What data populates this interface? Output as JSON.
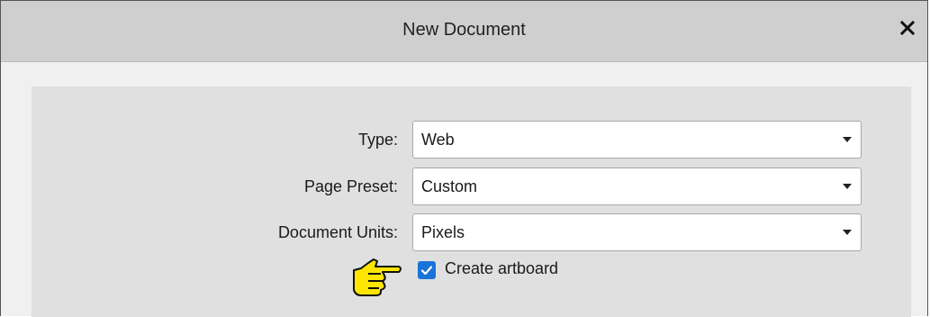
{
  "dialog": {
    "title": "New Document",
    "close_icon": "close-icon"
  },
  "form": {
    "type": {
      "label": "Type:",
      "value": "Web"
    },
    "page_preset": {
      "label": "Page Preset:",
      "value": "Custom"
    },
    "document_units": {
      "label": "Document Units:",
      "value": "Pixels"
    },
    "create_artboard": {
      "label": "Create artboard",
      "checked": true
    }
  },
  "annotation": {
    "icon": "pointing-hand-icon",
    "color": "#ffe600"
  },
  "colors": {
    "accent": "#1a73d9",
    "titlebar": "#cfcfcf",
    "panel": "#e0e0e0"
  }
}
